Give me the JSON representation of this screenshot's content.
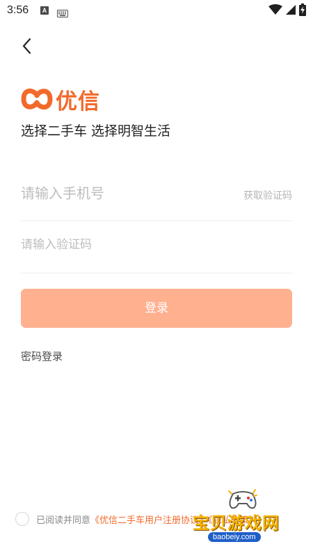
{
  "status_bar": {
    "time": "3:56",
    "a_badge": "A"
  },
  "icons": {
    "back": "chevron-left-icon",
    "logo": "uxin-logo-icon",
    "wifi": "wifi-icon",
    "signal": "signal-icon",
    "battery": "battery-charging-icon",
    "keyboard": "keyboard-icon"
  },
  "brand": {
    "logo_text": "优信",
    "slogan": "选择二手车 选择明智生活",
    "accent_color": "#f26a2b",
    "button_color": "#ffb08f"
  },
  "form": {
    "phone_placeholder": "请输入手机号",
    "phone_value": "",
    "get_code_label": "获取验证码",
    "code_placeholder": "请输入验证码",
    "code_value": "",
    "login_label": "登录",
    "password_login_label": "密码登录"
  },
  "agreement": {
    "checked": false,
    "prefix": "已阅读并同意",
    "link_text": "《优信二手车用户注册协议》《隐私政策》"
  },
  "watermark": {
    "title": "宝贝游戏网",
    "url": "baobeiy.com"
  }
}
